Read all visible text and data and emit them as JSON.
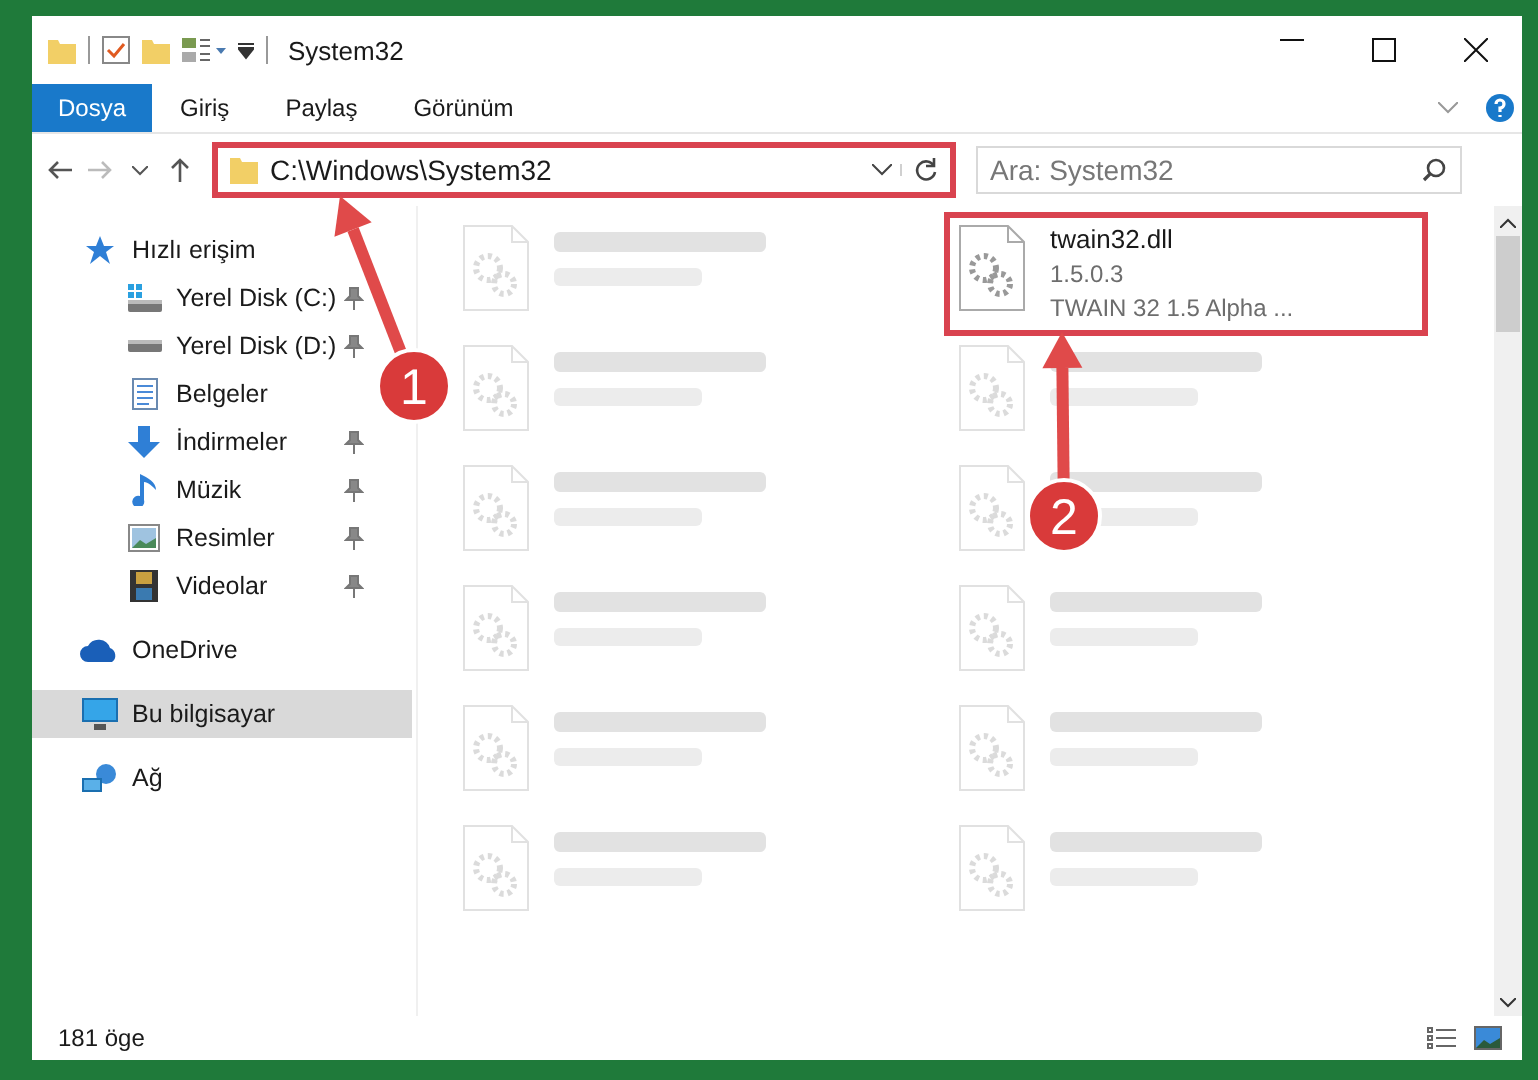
{
  "window": {
    "title": "System32"
  },
  "ribbon": {
    "tabs": [
      {
        "label": "Dosya",
        "kind": "file"
      },
      {
        "label": "Giriş",
        "kind": "tab"
      },
      {
        "label": "Paylaş",
        "kind": "tab"
      },
      {
        "label": "Görünüm",
        "kind": "tab"
      }
    ]
  },
  "address_bar": {
    "path": "C:\\Windows\\System32",
    "highlighted": true
  },
  "search": {
    "placeholder": "Ara: System32"
  },
  "sidebar": {
    "items": [
      {
        "label": "Hızlı erişim",
        "kind": "star",
        "selected": false,
        "children": [
          {
            "label": "Yerel Disk (C:)",
            "kind": "drive-c",
            "selected": false,
            "pinned": true
          },
          {
            "label": "Yerel Disk (D:)",
            "kind": "drive",
            "selected": false,
            "pinned": true
          },
          {
            "label": "Belgeler",
            "kind": "docs",
            "selected": false
          },
          {
            "label": "İndirmeler",
            "kind": "download",
            "selected": false,
            "pinned": true
          },
          {
            "label": "Müzik",
            "kind": "music",
            "selected": false,
            "pinned": true
          },
          {
            "label": "Resimler",
            "kind": "pictures",
            "selected": false,
            "pinned": true
          },
          {
            "label": "Videolar",
            "kind": "videos",
            "selected": false,
            "pinned": true
          }
        ]
      },
      {
        "label": "OneDrive",
        "kind": "cloud",
        "selected": false
      },
      {
        "label": "Bu bilgisayar",
        "kind": "pc",
        "selected": true
      },
      {
        "label": "Ağ",
        "kind": "network",
        "selected": false
      }
    ]
  },
  "files": [
    {
      "blurred": true
    },
    {
      "name": "twain32.dll",
      "type": "1.5.0.3",
      "description": "TWAIN 32 1.5 Alpha ...",
      "blurred": false,
      "highlighted": true
    },
    {
      "blurred": true
    },
    {
      "blurred": true
    },
    {
      "blurred": true
    },
    {
      "blurred": true
    },
    {
      "blurred": true
    },
    {
      "blurred": true
    },
    {
      "blurred": true
    },
    {
      "blurred": true
    },
    {
      "blurred": true
    },
    {
      "blurred": true
    }
  ],
  "status_bar": {
    "count": "181 öge"
  },
  "annotations": [
    {
      "number": "1"
    },
    {
      "number": "2"
    }
  ]
}
